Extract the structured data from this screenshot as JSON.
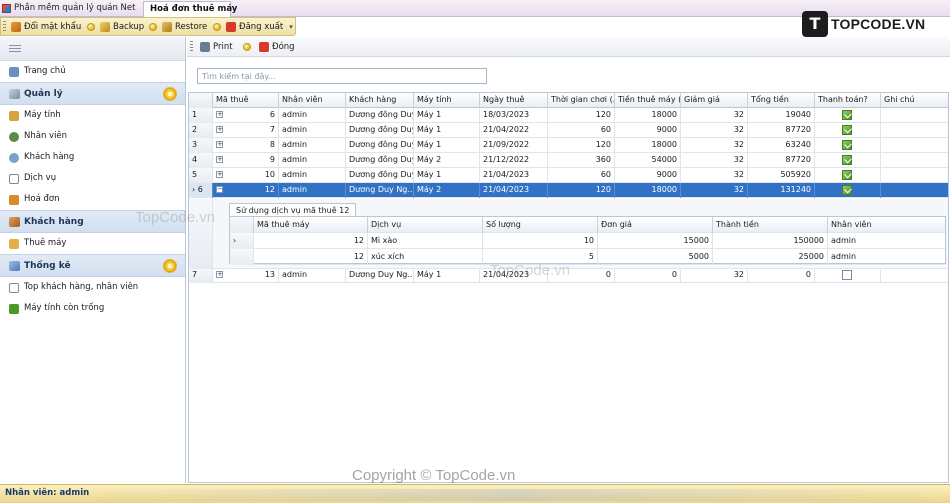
{
  "window_tabs": [
    {
      "label": "Phần mềm quản lý quán Net",
      "active": false
    },
    {
      "label": "Hoá đơn thuê máy",
      "active": true
    }
  ],
  "toolbar": {
    "items": [
      {
        "label": "Đổi mật khẩu",
        "icon": "user-key-icon"
      },
      {
        "label": "Backup",
        "icon": "pencil-icon"
      },
      {
        "label": "Restore",
        "icon": "database-icon"
      },
      {
        "label": "Đăng xuất",
        "icon": "logout-icon"
      }
    ]
  },
  "logo": {
    "mark": "T",
    "text": "TOPCODE.VN"
  },
  "nav": {
    "home": "Trang chủ",
    "groups": [
      {
        "title": "Quản lý",
        "items": [
          "Máy tính",
          "Nhân viên",
          "Khách hàng",
          "Dịch vụ",
          "Hoá đơn"
        ]
      },
      {
        "title": "Khách hàng",
        "items": [
          "Thuê máy"
        ]
      },
      {
        "title": "Thống kê",
        "items": [
          "Top khách hàng, nhân viên",
          "Máy tính còn trống"
        ]
      }
    ]
  },
  "content_toolbar": {
    "print": "Print",
    "close": "Đóng"
  },
  "search": {
    "placeholder": "Tìm kiếm tại đây..."
  },
  "grid": {
    "headers": [
      "Mã thuê",
      "Nhân viên",
      "Khách hàng",
      "Máy tính",
      "Ngày thuê",
      "Thời gian chơi (...",
      "Tiền thuê máy (...",
      "Giảm giá",
      "Tổng tiền",
      "Thanh toán?",
      "Ghi chú"
    ],
    "rows": [
      {
        "idx": "1",
        "ma": "6",
        "nv": "admin",
        "kh": "Dương đông Duy",
        "may": "Máy 1",
        "ngay": "18/03/2023",
        "tg": "120",
        "tien": "18000",
        "giam": "32",
        "tong": "19040",
        "paid": true,
        "note": ""
      },
      {
        "idx": "2",
        "ma": "7",
        "nv": "admin",
        "kh": "Dương đông Duy",
        "may": "Máy 1",
        "ngay": "21/04/2022",
        "tg": "60",
        "tien": "9000",
        "giam": "32",
        "tong": "87720",
        "paid": true,
        "note": ""
      },
      {
        "idx": "3",
        "ma": "8",
        "nv": "admin",
        "kh": "Dương đông Duy",
        "may": "Máy 1",
        "ngay": "21/09/2022",
        "tg": "120",
        "tien": "18000",
        "giam": "32",
        "tong": "63240",
        "paid": true,
        "note": ""
      },
      {
        "idx": "4",
        "ma": "9",
        "nv": "admin",
        "kh": "Dương đông Duy",
        "may": "Máy 2",
        "ngay": "21/12/2022",
        "tg": "360",
        "tien": "54000",
        "giam": "32",
        "tong": "87720",
        "paid": true,
        "note": ""
      },
      {
        "idx": "5",
        "ma": "10",
        "nv": "admin",
        "kh": "Dương đông Duy",
        "may": "Máy 1",
        "ngay": "21/04/2023",
        "tg": "60",
        "tien": "9000",
        "giam": "32",
        "tong": "505920",
        "paid": true,
        "note": ""
      },
      {
        "idx": "6",
        "ma": "12",
        "nv": "admin",
        "kh": "Dương Duy Ng...",
        "may": "Máy 2",
        "ngay": "21/04/2023",
        "tg": "120",
        "tien": "18000",
        "giam": "32",
        "tong": "131240",
        "paid": true,
        "note": ""
      },
      {
        "idx": "7",
        "ma": "13",
        "nv": "admin",
        "kh": "Dương Duy Ng...",
        "may": "Máy 1",
        "ngay": "21/04/2023",
        "tg": "0",
        "tien": "0",
        "giam": "32",
        "tong": "0",
        "paid": false,
        "note": ""
      }
    ],
    "selected_index": 5,
    "detail": {
      "tab": "Sử dụng dịch vụ mã thuê 12",
      "headers": [
        "Mã thuê máy",
        "Dịch vụ",
        "Số lượng",
        "Đơn giá",
        "Thành tiền",
        "Nhân viên"
      ],
      "rows": [
        {
          "ma": "12",
          "dv": "Mì xào",
          "sl": "10",
          "gia": "15000",
          "tt": "150000",
          "nv": "admin"
        },
        {
          "ma": "12",
          "dv": "xúc xích",
          "sl": "5",
          "gia": "5000",
          "tt": "25000",
          "nv": "admin"
        }
      ]
    }
  },
  "status": {
    "label": "Nhân viên: admin"
  },
  "watermarks": [
    "TopCode.vn",
    "TopCode.vn",
    "Copyright © TopCode.vn"
  ],
  "colors": {
    "selection": "#3272c4",
    "nav_group": "#d1dff0",
    "status_bar": "#ecd58a"
  }
}
